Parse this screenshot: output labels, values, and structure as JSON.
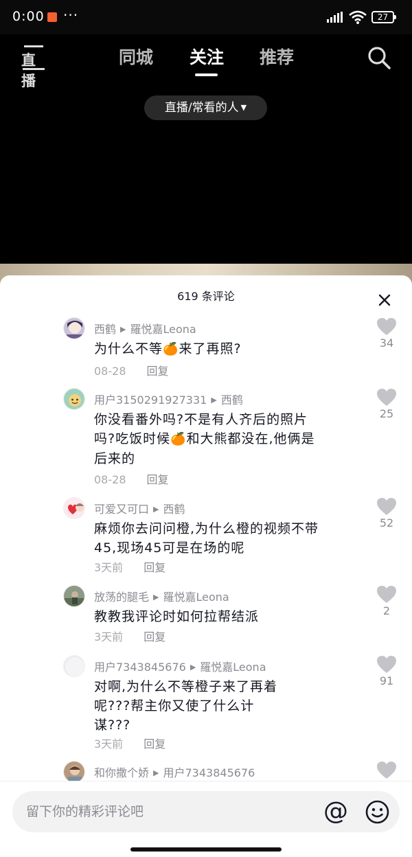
{
  "status_bar": {
    "time": "0:00",
    "dots": "···",
    "battery": "27"
  },
  "nav": {
    "tabs": [
      {
        "label": "同城"
      },
      {
        "label": "关注"
      },
      {
        "label": "推荐"
      }
    ],
    "active_tab": "关注",
    "live_icon_text": "直播"
  },
  "live_filter": {
    "label": "直播/常看的人"
  },
  "comments_sheet": {
    "count_label": "619 条评论",
    "comments": [
      {
        "user": "西鹤",
        "reply_to": "羅悦嘉Leona",
        "text_before": "为什么不等",
        "emoji": "🍊",
        "text_after": "来了再照?",
        "time": "08-28",
        "reply_label": "回复",
        "likes": "34"
      },
      {
        "user": "用户3150291927331",
        "reply_to": "西鹤",
        "text_line1": "你没看番外吗?不是有人齐后的照片",
        "text_line2_before": "吗?吃饭时候",
        "emoji": "🍊",
        "text_line2_after": "和大熊都没在,他俩是",
        "text_line3": "后来的",
        "time": "08-28",
        "reply_label": "回复",
        "likes": "25"
      },
      {
        "user": "可爱又可口",
        "reply_to": "西鹤",
        "text_line1": "麻烦你去问问橙,为什么橙的视频不带",
        "text_line2": "45,现场45可是在场的呢",
        "time": "3天前",
        "reply_label": "回复",
        "likes": "52"
      },
      {
        "user": "放荡的腿毛",
        "reply_to": "羅悦嘉Leona",
        "text_line1": "教教我评论时如何拉帮结派",
        "time": "3天前",
        "reply_label": "回复",
        "likes": "2"
      },
      {
        "user": "用户7343845676",
        "reply_to": "羅悦嘉Leona",
        "text_line1": "对啊,为什么不等橙子来了再着",
        "text_line2": "呢???帮主你又使了什么计",
        "text_line3": "谋???",
        "time": "3天前",
        "reply_label": "回复",
        "likes": "91"
      },
      {
        "user": "和你撒个娇",
        "reply_to": "用户7343845676"
      }
    ]
  },
  "input_bar": {
    "placeholder": "留下你的精彩评论吧"
  },
  "colors": {
    "background_top": "#000000",
    "sheet": "#ffffff",
    "muted_text": "#8a8b91"
  }
}
